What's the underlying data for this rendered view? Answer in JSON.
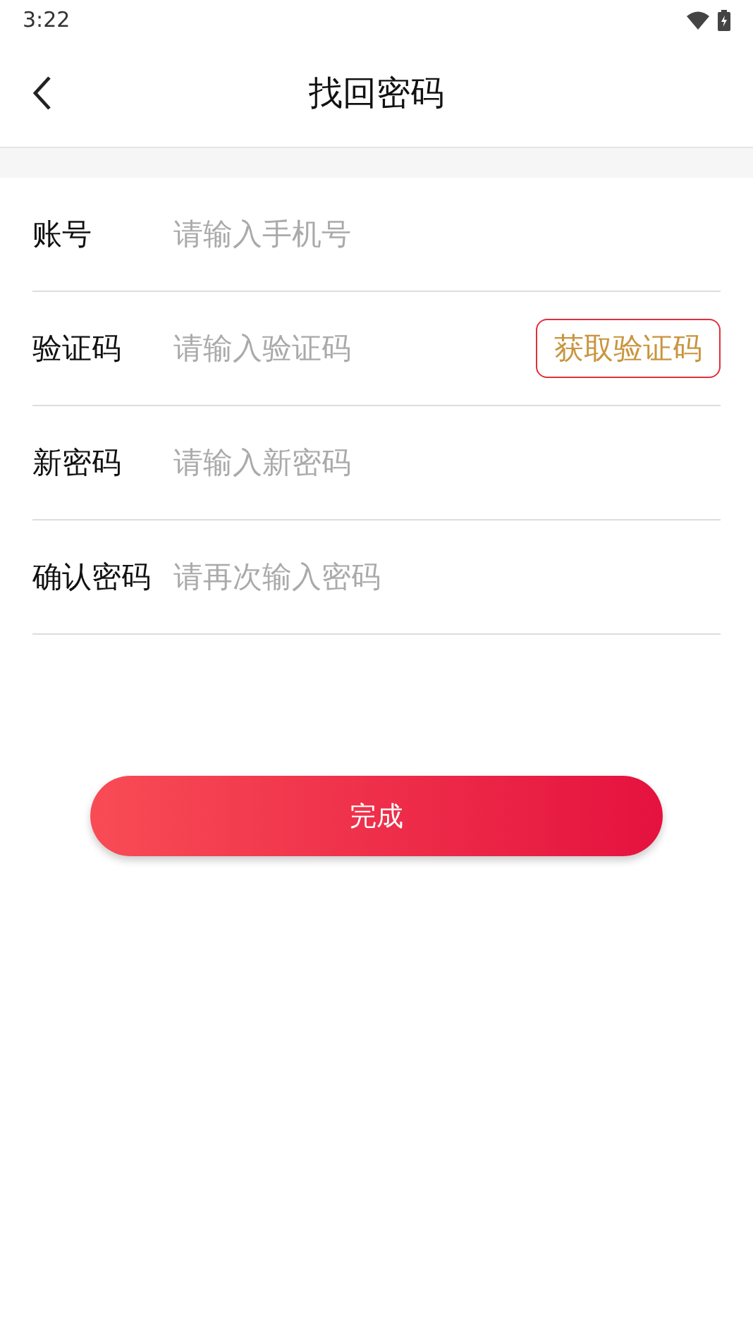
{
  "status_bar": {
    "time": "3:22"
  },
  "header": {
    "title": "找回密码"
  },
  "fields": [
    {
      "label": "账号",
      "placeholder": "请输入手机号",
      "kind": "text"
    },
    {
      "label": "验证码",
      "placeholder": "请输入验证码",
      "kind": "code",
      "action": "获取验证码"
    },
    {
      "label": "新密码",
      "placeholder": "请输入新密码",
      "kind": "text"
    },
    {
      "label": "确认密码",
      "placeholder": "请再次输入密码",
      "kind": "text"
    }
  ],
  "submit": "完成"
}
